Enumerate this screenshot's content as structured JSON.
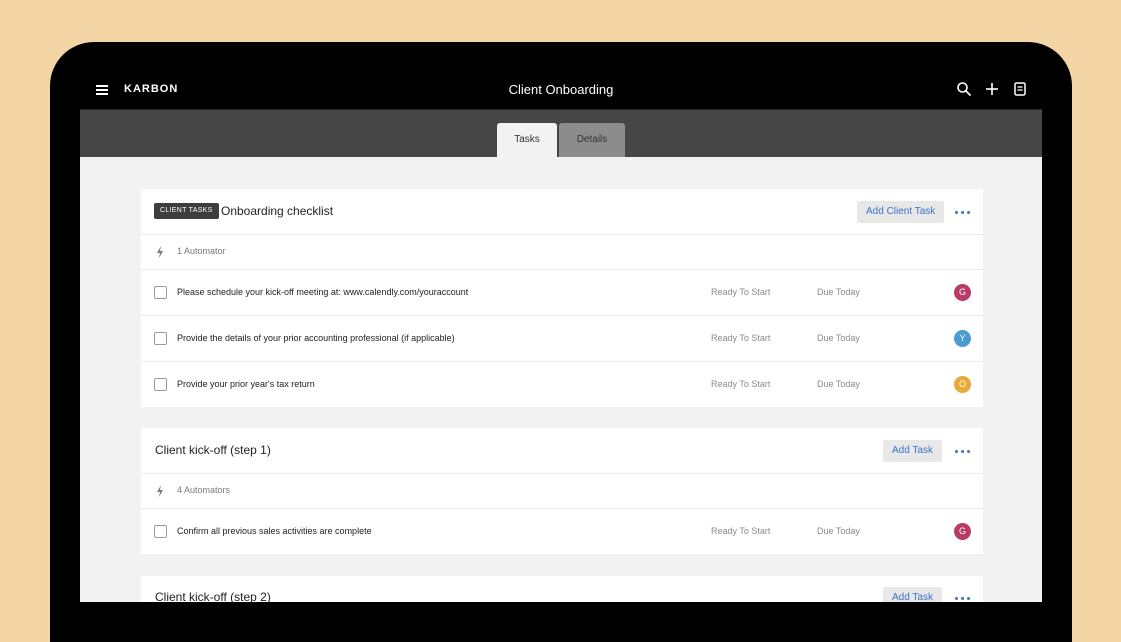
{
  "app": {
    "brand": "KARBON",
    "title": "Client Onboarding"
  },
  "header_icons": [
    "menu-icon",
    "search-icon",
    "plus-icon",
    "notes-icon"
  ],
  "tabs": [
    {
      "label": "Tasks",
      "active": true
    },
    {
      "label": "Details",
      "active": false
    }
  ],
  "colors": {
    "accent": "#3a74c9",
    "avatar_g": "#b83b68",
    "avatar_y": "#4a9bd1",
    "avatar_o": "#e8a936",
    "background": "#f4d5a6"
  },
  "sections": [
    {
      "badge": "CLIENT TASKS",
      "title": "Onboarding checklist",
      "add_label": "Add Client Task",
      "automators": "1 Automator",
      "tasks": [
        {
          "text": "Please schedule your kick-off meeting at: www.calendly.com/youraccount",
          "status": "Ready To Start",
          "due": "Due Today",
          "avatar": "G"
        },
        {
          "text": "Provide the details of your prior accounting professional (if applicable)",
          "status": "Ready To Start",
          "due": "Due Today",
          "avatar": "Y"
        },
        {
          "text": "Provide your prior year's tax return",
          "status": "Ready To Start",
          "due": "Due Today",
          "avatar": "O"
        }
      ]
    },
    {
      "title": "Client kick-off (step 1)",
      "add_label": "Add Task",
      "automators": "4 Automators",
      "tasks": [
        {
          "text": "Confirm all previous sales activities are complete",
          "status": "Ready To Start",
          "due": "Due Today",
          "avatar": "G"
        }
      ]
    },
    {
      "title": "Client kick-off (step 2)",
      "add_label": "Add Task"
    }
  ]
}
